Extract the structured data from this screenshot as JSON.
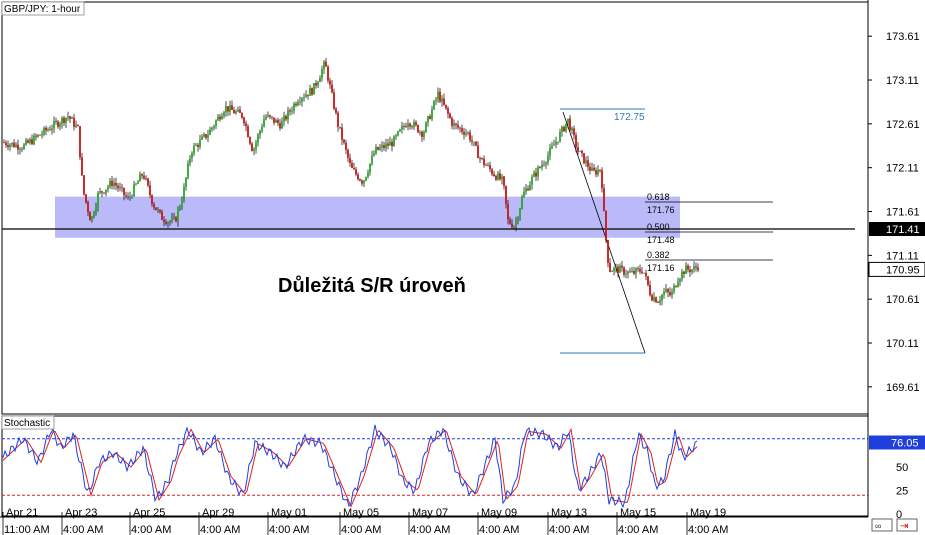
{
  "header": {
    "symbol_label": "GBP/JPY: 1-hour"
  },
  "annotation": {
    "title": "Důležitá S/R úroveň"
  },
  "colors": {
    "up_candle": "#22aa22",
    "down_candle": "#cc1111",
    "zone": "#8c8cf5",
    "horizontal_line": "#000000",
    "fib_line": "#000000",
    "high_line": "#3377bb",
    "low_line": "#3377bb",
    "stoch_k": "#1f3fdd",
    "stoch_d": "#dd2222",
    "upper_level": "#1f3fdd",
    "lower_level": "#dd2222",
    "badge_blue": "#1f3fdd"
  },
  "chart_data": [
    {
      "type": "candlestick",
      "title": "GBP/JPY: 1-hour",
      "ylim": [
        169.3,
        174.0
      ],
      "y_ticks": [
        "173.61",
        "173.11",
        "172.61",
        "172.11",
        "171.61",
        "171.11",
        "170.61",
        "170.11",
        "169.61"
      ],
      "x_ticks_top": [
        "Apr 21",
        "Apr 23",
        "Apr 25",
        "Apr 29",
        "May 01",
        "May 05",
        "May 07",
        "May 09",
        "May 13",
        "May 15",
        "May 19"
      ],
      "x_ticks_bottom": [
        "11:00 AM",
        "4:00 AM",
        "4:00 AM",
        "4:00 AM",
        "4:00 AM",
        "4:00 AM",
        "4:00 AM",
        "4:00 AM",
        "4:00 AM",
        "4:00 AM",
        "4:00 AM"
      ],
      "path": [
        [
          0,
          172.4
        ],
        [
          20,
          172.35
        ],
        [
          45,
          172.55
        ],
        [
          65,
          172.7
        ],
        [
          75,
          172.55
        ],
        [
          80,
          171.85
        ],
        [
          88,
          171.5
        ],
        [
          95,
          171.8
        ],
        [
          110,
          171.95
        ],
        [
          125,
          171.75
        ],
        [
          140,
          172.05
        ],
        [
          150,
          171.7
        ],
        [
          158,
          171.55
        ],
        [
          165,
          171.5
        ],
        [
          172,
          171.5
        ],
        [
          180,
          171.8
        ],
        [
          188,
          172.3
        ],
        [
          205,
          172.5
        ],
        [
          222,
          172.8
        ],
        [
          240,
          172.7
        ],
        [
          250,
          172.3
        ],
        [
          262,
          172.7
        ],
        [
          278,
          172.6
        ],
        [
          295,
          172.9
        ],
        [
          310,
          173.0
        ],
        [
          322,
          173.3
        ],
        [
          335,
          172.6
        ],
        [
          348,
          172.1
        ],
        [
          360,
          171.95
        ],
        [
          372,
          172.3
        ],
        [
          390,
          172.4
        ],
        [
          405,
          172.65
        ],
        [
          420,
          172.5
        ],
        [
          435,
          172.95
        ],
        [
          450,
          172.6
        ],
        [
          465,
          172.5
        ],
        [
          478,
          172.2
        ],
        [
          490,
          172.05
        ],
        [
          500,
          171.95
        ],
        [
          505,
          171.5
        ],
        [
          512,
          171.45
        ],
        [
          520,
          171.8
        ],
        [
          530,
          172.0
        ],
        [
          545,
          172.25
        ],
        [
          560,
          172.55
        ],
        [
          565,
          172.65
        ],
        [
          575,
          172.3
        ],
        [
          590,
          172.05
        ],
        [
          598,
          172.1
        ],
        [
          602,
          171.4
        ],
        [
          606,
          170.95
        ],
        [
          615,
          170.95
        ],
        [
          628,
          170.9
        ],
        [
          640,
          170.95
        ],
        [
          648,
          170.65
        ],
        [
          655,
          170.6
        ],
        [
          662,
          170.7
        ],
        [
          668,
          170.65
        ],
        [
          675,
          170.85
        ],
        [
          682,
          170.95
        ],
        [
          690,
          170.95
        ],
        [
          695,
          170.99
        ]
      ],
      "support_zone": [
        171.31,
        171.78
      ],
      "sr_level": {
        "value": 171.41,
        "label": "171.41"
      },
      "last_price": {
        "value": 170.95,
        "label": "170.95"
      },
      "swing_high": {
        "value": 172.75,
        "label": "172.75"
      },
      "swing_low": {
        "value": 170.17
      },
      "fib_levels": [
        {
          "ratio": "0.618",
          "value": "171.76"
        },
        {
          "ratio": "0.500",
          "value": "171.48"
        },
        {
          "ratio": "0.382",
          "value": "171.16"
        }
      ]
    },
    {
      "type": "line",
      "title": "Stochastic",
      "ylim": [
        0,
        100
      ],
      "y_ticks": [
        "50",
        "25",
        "0"
      ],
      "levels": [
        80,
        20
      ],
      "current_value": {
        "value": 76.05,
        "label": "76.05"
      },
      "path": [
        [
          0,
          60
        ],
        [
          20,
          80
        ],
        [
          35,
          55
        ],
        [
          48,
          90
        ],
        [
          58,
          70
        ],
        [
          70,
          85
        ],
        [
          85,
          20
        ],
        [
          96,
          55
        ],
        [
          110,
          65
        ],
        [
          125,
          50
        ],
        [
          140,
          70
        ],
        [
          153,
          15
        ],
        [
          165,
          35
        ],
        [
          172,
          60
        ],
        [
          185,
          90
        ],
        [
          198,
          65
        ],
        [
          212,
          80
        ],
        [
          225,
          40
        ],
        [
          240,
          20
        ],
        [
          252,
          75
        ],
        [
          268,
          65
        ],
        [
          282,
          50
        ],
        [
          300,
          80
        ],
        [
          318,
          75
        ],
        [
          330,
          45
        ],
        [
          345,
          8
        ],
        [
          358,
          40
        ],
        [
          372,
          90
        ],
        [
          388,
          70
        ],
        [
          400,
          35
        ],
        [
          412,
          25
        ],
        [
          425,
          75
        ],
        [
          440,
          90
        ],
        [
          455,
          40
        ],
        [
          470,
          20
        ],
        [
          485,
          60
        ],
        [
          492,
          80
        ],
        [
          500,
          15
        ],
        [
          512,
          30
        ],
        [
          522,
          88
        ],
        [
          540,
          85
        ],
        [
          555,
          70
        ],
        [
          565,
          90
        ],
        [
          575,
          25
        ],
        [
          585,
          40
        ],
        [
          598,
          65
        ],
        [
          606,
          15
        ],
        [
          622,
          12
        ],
        [
          635,
          85
        ],
        [
          645,
          65
        ],
        [
          652,
          30
        ],
        [
          660,
          35
        ],
        [
          672,
          85
        ],
        [
          680,
          60
        ],
        [
          695,
          76
        ]
      ]
    }
  ]
}
